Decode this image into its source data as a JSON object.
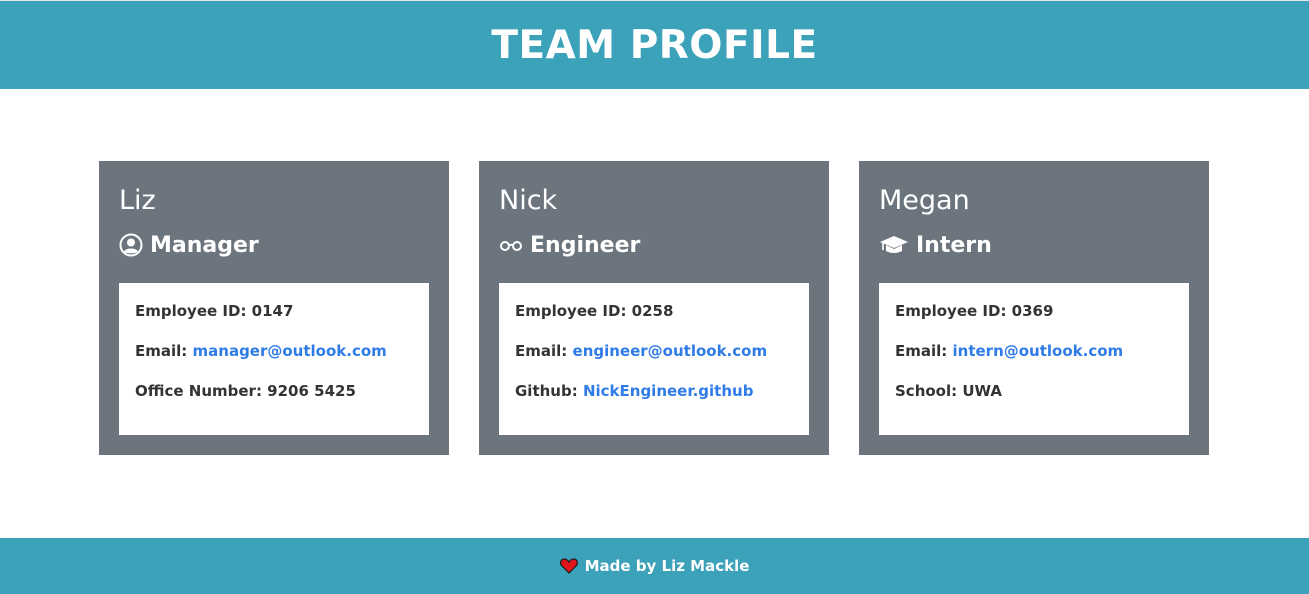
{
  "header": {
    "title": "TEAM PROFILE"
  },
  "colors": {
    "header_bg": "#3ca2ba",
    "card_bg": "#6c757d",
    "link": "#2f7ce8",
    "heart": "#e0161e"
  },
  "employees": [
    {
      "name": "Liz",
      "role": "Manager",
      "icon": "user-circle-icon",
      "id_label": "Employee ID: ",
      "id": "0147",
      "email_label": "Email: ",
      "email": "manager@outlook.com",
      "extra_label": "Office Number: ",
      "extra_value": "9206 5425"
    },
    {
      "name": "Nick",
      "role": "Engineer",
      "icon": "glasses-icon",
      "id_label": "Employee ID: ",
      "id": "0258",
      "email_label": "Email: ",
      "email": "engineer@outlook.com",
      "extra_label": "Github: ",
      "extra_value": "NickEngineer.github"
    },
    {
      "name": "Megan",
      "role": "Intern",
      "icon": "graduation-cap-icon",
      "id_label": "Employee ID: ",
      "id": "0369",
      "email_label": "Email: ",
      "email": "intern@outlook.com",
      "extra_label": "School: ",
      "extra_value": "UWA"
    }
  ],
  "footer": {
    "icon": "heart-icon",
    "text": "Made by Liz Mackle"
  }
}
